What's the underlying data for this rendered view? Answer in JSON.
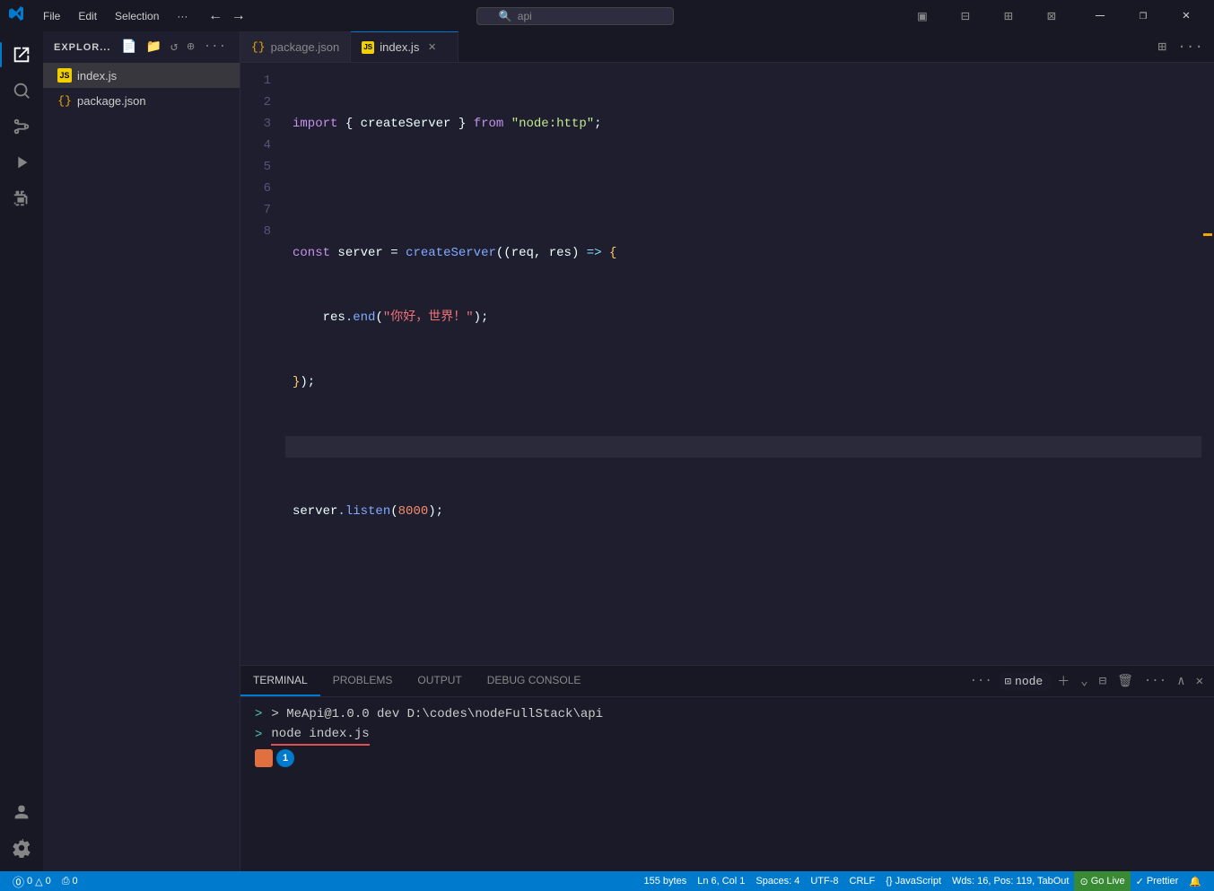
{
  "titlebar": {
    "menu_items": [
      "File",
      "Edit",
      "Selection",
      "···"
    ],
    "nav_back": "←",
    "nav_forward": "→",
    "search_placeholder": "api",
    "controls": [
      "⊟",
      "❐",
      "✕"
    ],
    "layout_icons": [
      "▣",
      "⊞",
      "⊠",
      "⊟"
    ]
  },
  "activity_bar": {
    "items": [
      {
        "name": "explorer",
        "icon": "⧉",
        "active": true
      },
      {
        "name": "search",
        "icon": "🔍"
      },
      {
        "name": "source-control",
        "icon": "⑂"
      },
      {
        "name": "run-debug",
        "icon": "▷"
      },
      {
        "name": "extensions",
        "icon": "⊞"
      }
    ],
    "bottom_items": [
      {
        "name": "profile",
        "icon": "⊙"
      },
      {
        "name": "settings",
        "icon": "⚙"
      }
    ]
  },
  "sidebar": {
    "title": "EXPLOR...",
    "action_icons": [
      "📄+",
      "📁+",
      "↺",
      "⊕"
    ],
    "files": [
      {
        "name": "index.js",
        "type": "js",
        "active": true
      },
      {
        "name": "package.json",
        "type": "json",
        "active": false
      }
    ]
  },
  "tabs": [
    {
      "name": "package.json",
      "type": "json",
      "active": false,
      "closeable": false
    },
    {
      "name": "index.js",
      "type": "js",
      "active": true,
      "closeable": true
    }
  ],
  "code": {
    "lines": [
      {
        "num": 1,
        "tokens": [
          {
            "t": "kw-import",
            "v": "import"
          },
          {
            "t": "plain",
            "v": " { "
          },
          {
            "t": "plain",
            "v": "createServer"
          },
          {
            "t": "plain",
            "v": " } "
          },
          {
            "t": "kw-from",
            "v": "from"
          },
          {
            "t": "plain",
            "v": " "
          },
          {
            "t": "str",
            "v": "\"node:http\""
          },
          {
            "t": "plain",
            "v": ";"
          }
        ]
      },
      {
        "num": 2,
        "tokens": []
      },
      {
        "num": 3,
        "tokens": [
          {
            "t": "kw-const",
            "v": "const"
          },
          {
            "t": "plain",
            "v": " "
          },
          {
            "t": "var-name",
            "v": "server"
          },
          {
            "t": "plain",
            "v": " = "
          },
          {
            "t": "fn-name",
            "v": "createServer"
          },
          {
            "t": "plain",
            "v": "(("
          },
          {
            "t": "var-name",
            "v": "req"
          },
          {
            "t": "plain",
            "v": ", "
          },
          {
            "t": "var-name",
            "v": "res"
          },
          {
            "t": "plain",
            "v": ") "
          },
          {
            "t": "kw-arrow",
            "v": "=>"
          },
          {
            "t": "plain",
            "v": " "
          },
          {
            "t": "brace",
            "v": "{"
          }
        ]
      },
      {
        "num": 4,
        "tokens": [
          {
            "t": "plain",
            "v": "    "
          },
          {
            "t": "var-name",
            "v": "res"
          },
          {
            "t": "punct",
            "v": "."
          },
          {
            "t": "method",
            "v": "end"
          },
          {
            "t": "plain",
            "v": "("
          },
          {
            "t": "str-red",
            "v": "\"你好，世界！\""
          },
          {
            "t": "plain",
            "v": ")"
          },
          {
            "t": "plain",
            "v": ";"
          }
        ]
      },
      {
        "num": 5,
        "tokens": [
          {
            "t": "brace",
            "v": "}"
          },
          {
            "t": "plain",
            "v": "});"
          }
        ]
      },
      {
        "num": 6,
        "tokens": []
      },
      {
        "num": 7,
        "tokens": [
          {
            "t": "var-name",
            "v": "server"
          },
          {
            "t": "punct",
            "v": "."
          },
          {
            "t": "method",
            "v": "listen"
          },
          {
            "t": "plain",
            "v": "("
          },
          {
            "t": "num",
            "v": "8000"
          },
          {
            "t": "plain",
            "v": ")"
          },
          {
            "t": "plain",
            "v": ";"
          }
        ]
      },
      {
        "num": 8,
        "tokens": []
      }
    ]
  },
  "terminal": {
    "tabs": [
      {
        "name": "TERMINAL",
        "active": true
      },
      {
        "name": "PROBLEMS",
        "active": false
      },
      {
        "name": "OUTPUT",
        "active": false
      },
      {
        "name": "DEBUG CONSOLE",
        "active": false
      }
    ],
    "current_shell": "node",
    "lines": [
      "> MeApi@1.0.0 dev D:\\codes\\nodeFullStack\\api",
      "> node index.js"
    ],
    "badge_number": "1"
  },
  "statusbar": {
    "left_items": [
      {
        "id": "git-branch",
        "text": "⓪ 0 △ 0"
      },
      {
        "id": "sync",
        "text": "⎙ 0"
      }
    ],
    "right_items": [
      {
        "id": "position",
        "text": "Ln 6, Col 1"
      },
      {
        "id": "spaces",
        "text": "Spaces: 4"
      },
      {
        "id": "encoding",
        "text": "UTF-8"
      },
      {
        "id": "line-ending",
        "text": "CRLF"
      },
      {
        "id": "language",
        "text": "{} JavaScript"
      },
      {
        "id": "file-size",
        "text": "155 bytes"
      },
      {
        "id": "wds",
        "text": "Wds: 16, Pos: 119, TabOut"
      },
      {
        "id": "go-live",
        "text": "⊙ Go Live"
      },
      {
        "id": "prettier",
        "text": "✓ Prettier"
      },
      {
        "id": "notifications",
        "text": "🔔"
      }
    ]
  },
  "labels": {
    "import": "import",
    "from": "from",
    "const": "const",
    "create_server": "createServer",
    "req": "req",
    "res": "res",
    "arrow": "=>",
    "res_end": "res.end",
    "hello_world": "\"你好，世界！\"",
    "server_listen": "server.listen",
    "port": "8000"
  }
}
